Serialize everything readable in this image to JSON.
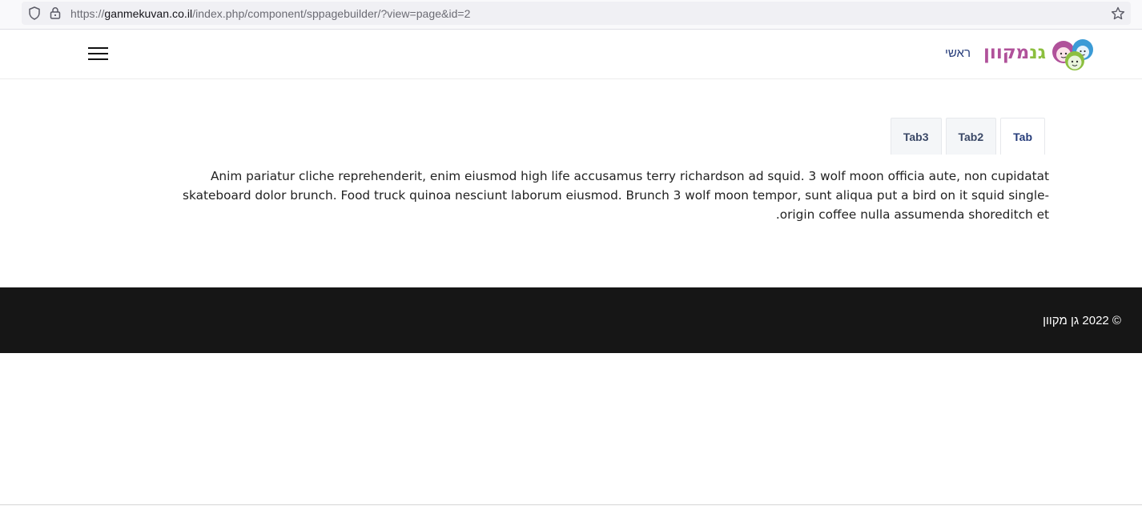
{
  "browser": {
    "url_scheme": "https://",
    "url_host": "ganmekuvan.co.il",
    "url_path": "/index.php/component/sppagebuilder/?view=page&id=2",
    "icons": {
      "shield": "shield-icon",
      "lock": "lock-icon",
      "bookmark": "star-icon"
    }
  },
  "header": {
    "logo_text_part1": "גנ",
    "logo_text_part2": "מקוון",
    "nav_home": "ראשי",
    "menu_icon": "hamburger-menu-icon"
  },
  "tabs": [
    {
      "label": "Tab",
      "active": true
    },
    {
      "label": "Tab2",
      "active": false
    },
    {
      "label": "Tab3",
      "active": false
    }
  ],
  "tab_content": "Anim pariatur cliche reprehenderit, enim eiusmod high life accusamus terry richardson ad squid. 3 wolf moon officia aute, non cupidatat skateboard dolor brunch. Food truck quinoa nesciunt laborum eiusmod. Brunch 3 wolf moon tempor, sunt aliqua put a bird on it squid single-origin coffee nulla assumenda shoreditch et.",
  "footer": {
    "copyright": "© 2022 גן מקוון"
  },
  "colors": {
    "logo_green": "#8cbf3f",
    "logo_purple": "#b0519a",
    "logo_blue": "#3b9bd6",
    "nav_text": "#263c7a",
    "footer_bg": "#161616"
  }
}
